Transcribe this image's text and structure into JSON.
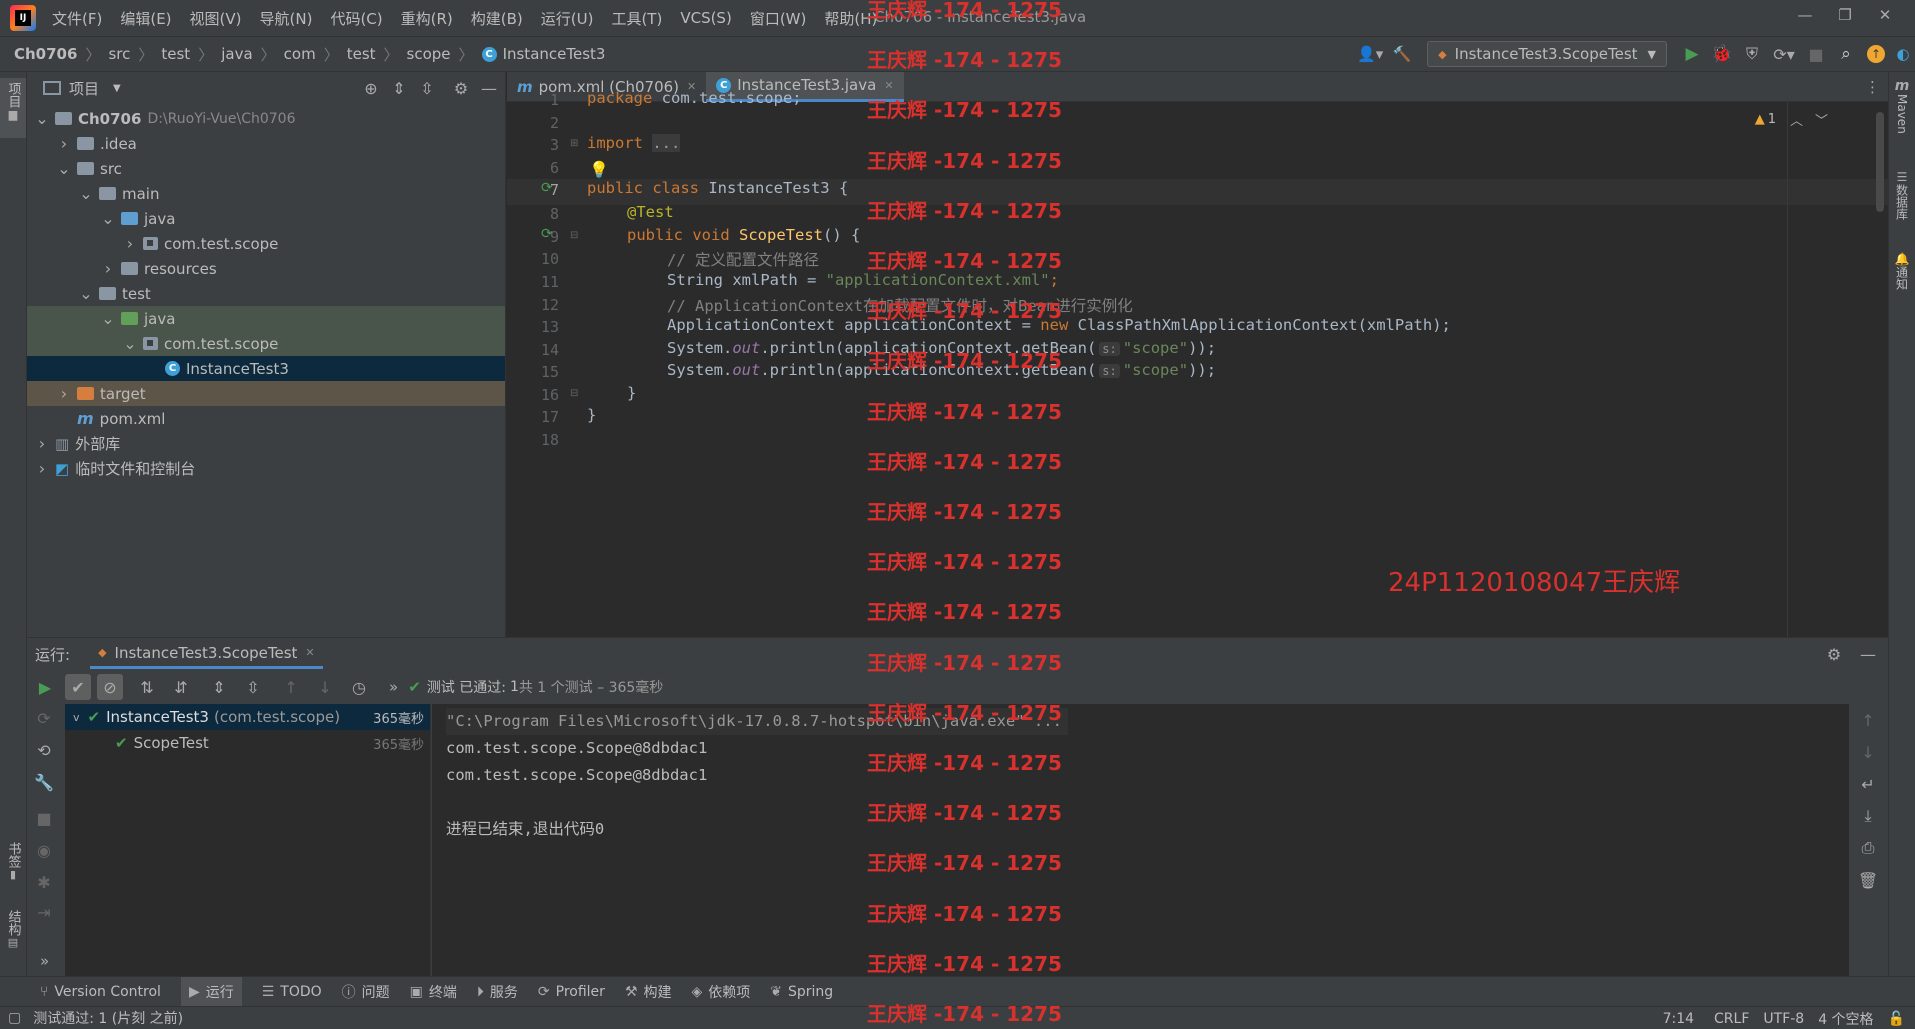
{
  "window": {
    "title": "Ch0706 - InstanceTest3.java",
    "menu": [
      "文件(F)",
      "编辑(E)",
      "视图(V)",
      "导航(N)",
      "代码(C)",
      "重构(R)",
      "构建(B)",
      "运行(U)",
      "工具(T)",
      "VCS(S)",
      "窗口(W)",
      "帮助(H)"
    ]
  },
  "breadcrumb": [
    "Ch0706",
    "src",
    "test",
    "java",
    "com",
    "test",
    "scope",
    "InstanceTest3"
  ],
  "run_config": "InstanceTest3.ScopeTest",
  "project": {
    "header": "项目",
    "tree": [
      {
        "label": "Ch0706",
        "extra": "D:\\RuoYi-Vue\\Ch0706",
        "indent": 0,
        "chev": "v",
        "icon": "folder"
      },
      {
        "label": ".idea",
        "indent": 1,
        "chev": ">",
        "icon": "folder"
      },
      {
        "label": "src",
        "indent": 1,
        "chev": "v",
        "icon": "folder"
      },
      {
        "label": "main",
        "indent": 2,
        "chev": "v",
        "icon": "folder"
      },
      {
        "label": "java",
        "indent": 3,
        "chev": "v",
        "icon": "src"
      },
      {
        "label": "com.test.scope",
        "indent": 4,
        "chev": ">",
        "icon": "pkg"
      },
      {
        "label": "resources",
        "indent": 3,
        "chev": ">",
        "icon": "res"
      },
      {
        "label": "test",
        "indent": 2,
        "chev": "v",
        "icon": "folder"
      },
      {
        "label": "java",
        "indent": 3,
        "chev": "v",
        "icon": "test"
      },
      {
        "label": "com.test.scope",
        "indent": 4,
        "chev": "v",
        "icon": "pkg"
      },
      {
        "label": "InstanceTest3",
        "indent": 5,
        "chev": "",
        "icon": "class"
      },
      {
        "label": "target",
        "indent": 1,
        "chev": ">",
        "icon": "target"
      },
      {
        "label": "pom.xml",
        "indent": 1,
        "chev": "",
        "icon": "maven"
      },
      {
        "label": "外部库",
        "indent": 0,
        "chev": ">",
        "icon": "lib"
      },
      {
        "label": "临时文件和控制台",
        "indent": 0,
        "chev": ">",
        "icon": "scratch"
      }
    ]
  },
  "editor": {
    "tabs": [
      "pom.xml (Ch0706)",
      "InstanceTest3.java"
    ],
    "warnings": "1",
    "line_numbers": [
      "1",
      "2",
      "3",
      "6",
      "7",
      "8",
      "9",
      "10",
      "11",
      "12",
      "13",
      "14",
      "15",
      "16",
      "17",
      "18"
    ],
    "code": {
      "l1a": "package",
      "l1b": " com.test.scope;",
      "l3a": "import",
      "l3b": "...",
      "l7a": "public class",
      "l7b": "InstanceTest3",
      "l7c": " {",
      "l8": "@Test",
      "l9a": "public void",
      "l9b": "ScopeTest",
      "l9c": "() {",
      "l10": "// 定义配置文件路径",
      "l11a": "String xmlPath = ",
      "l11b": "\"applicationContext.xml\"",
      "l11c": ";",
      "l12": "// ApplicationContext在加载配置文件时，对Bean进行实例化",
      "l13a": "ApplicationContext applicationContext = ",
      "l13b": "new",
      "l13c": " ClassPathXmlApplicationContext(xmlPath);",
      "l14a": "System.",
      "l14b": "out",
      "l14c": ".println(applicationContext.getBean(",
      "l14h": "s:",
      "l14d": "\"scope\"",
      "l14e": "));",
      "l15a": "System.",
      "l15b": "out",
      "l15c": ".println(applicationContext.getBean(",
      "l15h": "s:",
      "l15d": "\"scope\"",
      "l15e": "));",
      "l16": "}",
      "l17": "}"
    }
  },
  "watermark": {
    "repeat": "王庆辉 -174 - 1275",
    "tag": "24P1120108047王庆辉"
  },
  "run": {
    "label": "运行:",
    "tab": "InstanceTest3.ScopeTest",
    "status_prefix": "测试 已通过:",
    "status_count": "1",
    "status_suffix": "共 1 个测试 – 365毫秒",
    "tests": [
      {
        "name": "InstanceTest3",
        "pkg": "(com.test.scope)",
        "time": "365毫秒"
      },
      {
        "name": "ScopeTest",
        "time": "365毫秒"
      }
    ],
    "console": [
      "\"C:\\Program Files\\Microsoft\\jdk-17.0.8.7-hotspot\\bin\\java.exe\" ...",
      "com.test.scope.Scope@8dbdac1",
      "com.test.scope.Scope@8dbdac1",
      "",
      "进程已结束,退出代码0"
    ]
  },
  "bottom_tabs": [
    "Version Control",
    "运行",
    "TODO",
    "问题",
    "终端",
    "服务",
    "Profiler",
    "构建",
    "依赖项",
    "Spring"
  ],
  "status": {
    "message": "测试通过: 1 (片刻 之前)",
    "position": "7:14",
    "line_sep": "CRLF",
    "encoding": "UTF-8",
    "indent": "4 个空格"
  },
  "side_left": [
    "项目",
    "书签",
    "结构"
  ],
  "side_right": [
    "Maven",
    "数据库",
    "通知"
  ]
}
